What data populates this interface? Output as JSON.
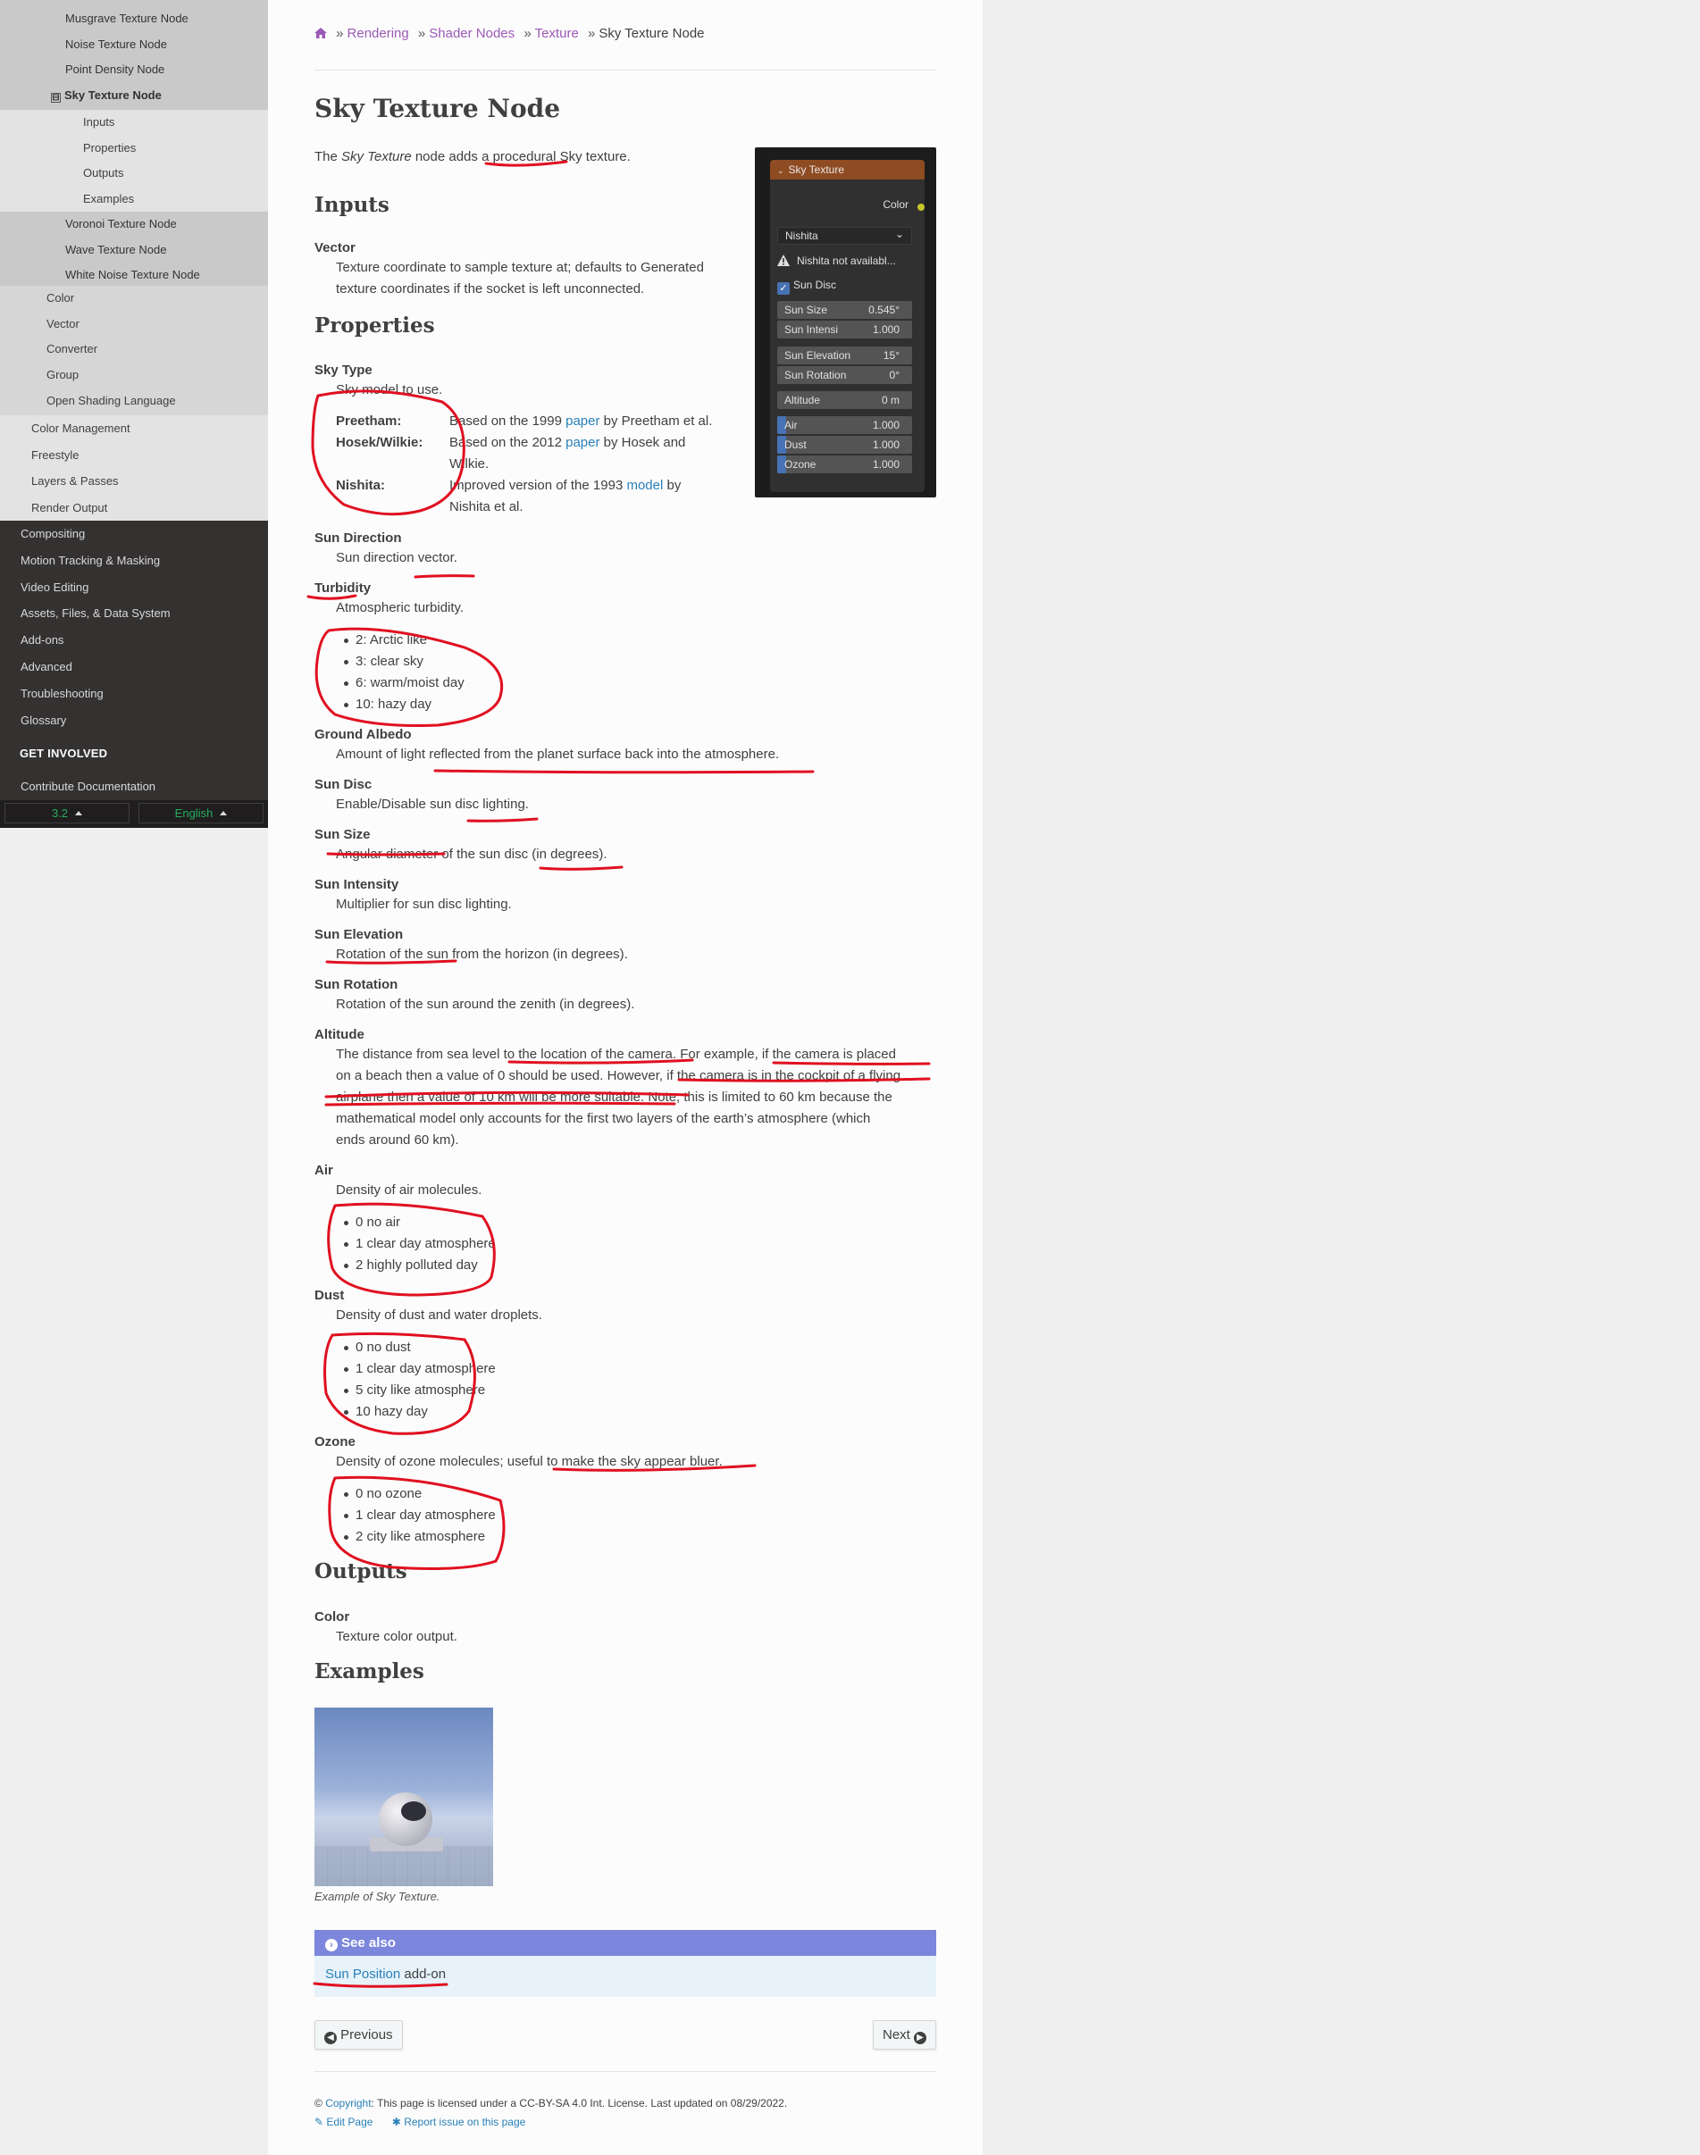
{
  "sidebar": {
    "level4_items": [
      "Musgrave Texture Node",
      "Noise Texture Node",
      "Point Density Node"
    ],
    "current": "Sky Texture Node",
    "current_toggle": "⊟",
    "level5_items": [
      "Inputs",
      "Properties",
      "Outputs",
      "Examples"
    ],
    "level4_after": [
      "Voronoi Texture Node",
      "Wave Texture Node",
      "White Noise Texture Node"
    ],
    "level3_items": [
      "Color",
      "Vector",
      "Converter",
      "Group",
      "Open Shading Language"
    ],
    "level2_items": [
      "Color Management",
      "Freestyle",
      "Layers & Passes",
      "Render Output"
    ],
    "level1_items": [
      "Compositing",
      "Motion Tracking & Masking",
      "Video Editing",
      "Assets, Files, & Data System",
      "Add-ons",
      "Advanced",
      "Troubleshooting",
      "Glossary"
    ],
    "caption": "GET INVOLVED",
    "contribute": "Contribute Documentation",
    "version": "3.2",
    "language": "English"
  },
  "breadcrumb": {
    "items": [
      "Rendering",
      "Shader Nodes",
      "Texture"
    ],
    "current": "Sky Texture Node"
  },
  "page": {
    "title": "Sky Texture Node",
    "intro_pre": "The ",
    "intro_em": "Sky Texture",
    "intro_post": " node adds a procedural Sky texture.",
    "h_inputs": "Inputs",
    "vector_term": "Vector",
    "vector_desc": "Texture coordinate to sample texture at; defaults to Generated texture coordinates if the socket is left unconnected.",
    "h_properties": "Properties",
    "skytype_term": "Sky Type",
    "skytype_desc": "Sky model to use.",
    "skytypes": [
      {
        "name": "Preetham:",
        "pre": "Based on the 1999 ",
        "link": "paper",
        "post": " by Preetham et al."
      },
      {
        "name": "Hosek/Wilkie:",
        "pre": "Based on the 2012 ",
        "link": "paper",
        "post": " by Hosek and",
        "line2": "Wilkie."
      },
      {
        "name": "Nishita:",
        "pre": "Improved version of the 1993 ",
        "link": "model",
        "post": " by",
        "line2": "Nishita et al."
      }
    ],
    "sundir_term": "Sun Direction",
    "sundir_desc": "Sun direction vector.",
    "turbidity_term": "Turbidity",
    "turbidity_desc": "Atmospheric turbidity.",
    "turbidity_list": [
      "2: Arctic like",
      "3: clear sky",
      "6: warm/moist day",
      "10: hazy day"
    ],
    "albedo_term": "Ground Albedo",
    "albedo_desc": "Amount of light reflected from the planet surface back into the atmosphere.",
    "sundisc_term": "Sun Disc",
    "sundisc_desc": "Enable/Disable sun disc lighting.",
    "sunsize_term": "Sun Size",
    "sunsize_desc": "Angular diameter of the sun disc (in degrees).",
    "sunint_term": "Sun Intensity",
    "sunint_desc": "Multiplier for sun disc lighting.",
    "sunelev_term": "Sun Elevation",
    "sunelev_desc": "Rotation of the sun from the horizon (in degrees).",
    "sunrot_term": "Sun Rotation",
    "sunrot_desc": "Rotation of the sun around the zenith (in degrees).",
    "altitude_term": "Altitude",
    "altitude_lines": [
      "The distance from sea level to the location of the camera. For example, if the camera is placed",
      "on a beach then a value of 0 should be used. However, if the camera is in the cockpit of a flying",
      "airplane then a value of 10 km will be more suitable. Note, this is limited to 60 km because the",
      "mathematical model only accounts for the first two layers of the earth’s atmosphere (which",
      "ends around 60 km)."
    ],
    "air_term": "Air",
    "air_desc": "Density of air molecules.",
    "air_list": [
      "0 no air",
      "1 clear day atmosphere",
      "2 highly polluted day"
    ],
    "dust_term": "Dust",
    "dust_desc": "Density of dust and water droplets.",
    "dust_list": [
      "0 no dust",
      "1 clear day atmosphere",
      "5 city like atmosphere",
      "10 hazy day"
    ],
    "ozone_term": "Ozone",
    "ozone_desc": "Density of ozone molecules; useful to make the sky appear bluer.",
    "ozone_list": [
      "0 no ozone",
      "1 clear day atmosphere",
      "2 city like atmosphere"
    ],
    "h_outputs": "Outputs",
    "color_term": "Color",
    "color_desc": "Texture color output.",
    "h_examples": "Examples",
    "example_caption": "Example of Sky Texture.",
    "seealso_title": "See also",
    "seealso_link": "Sun Position",
    "seealso_post": " add-on",
    "prev": "Previous",
    "next": "Next",
    "footer_copyright": "Copyright",
    "footer_text": ": This page is licensed under a CC-BY-SA 4.0 Int. License. Last updated on 08/29/2022.",
    "footer_edit": "Edit Page",
    "footer_report": "Report issue on this page"
  },
  "node_panel": {
    "header": "Sky Texture",
    "output": "Color",
    "sky_type": "Nishita",
    "warning": "Nishita not availabl...",
    "sun_disc": "Sun Disc",
    "fields": [
      {
        "label": "Sun Size",
        "value": "0.545°"
      },
      {
        "label": "Sun Intensi",
        "value": "1.000"
      },
      {
        "label": "Sun Elevation",
        "value": "15°"
      },
      {
        "label": "Sun Rotation",
        "value": "0°"
      },
      {
        "label": "Altitude",
        "value": "0 m"
      },
      {
        "label": "Air",
        "value": "1.000"
      },
      {
        "label": "Dust",
        "value": "1.000"
      },
      {
        "label": "Ozone",
        "value": "1.000"
      }
    ]
  },
  "colors": {
    "sidebar_dark": "#343131",
    "link": "#9b59b6",
    "link_blue": "#2980b9",
    "version_green": "#27ae60",
    "seealso_header": "#7b86dc",
    "annotation_red": "#e01020",
    "node_header": "#8f4b22"
  }
}
